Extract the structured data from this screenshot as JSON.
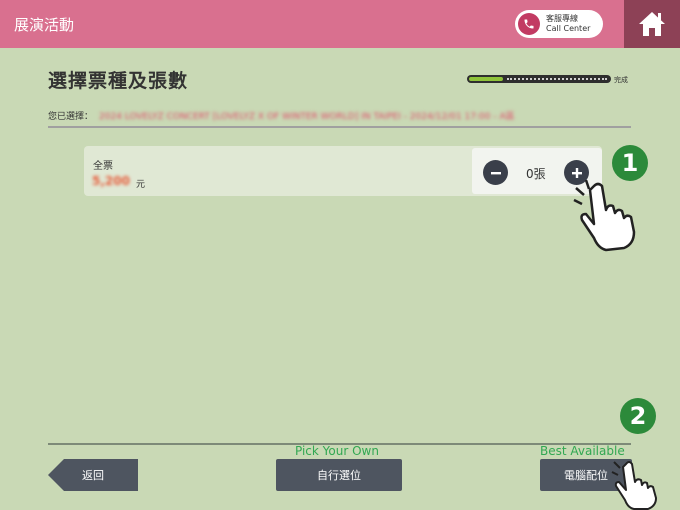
{
  "header": {
    "title": "展演活動",
    "call_center": {
      "line1": "客服專線",
      "line2": "Call Center"
    }
  },
  "page": {
    "title": "選擇票種及張數",
    "progress": {
      "label": "完成",
      "fraction": 0.25
    },
    "selected_label": "您已選擇：",
    "selected_value": "2024 LOVELYZ CONCERT [LOVELYZ X OF WINTER WORLD] IN TAIPEI - 2024/12/01 17:00 - A區"
  },
  "ticket": {
    "name": "全票",
    "price": "5,200",
    "unit": "元",
    "quantity": "0張"
  },
  "footer": {
    "back_label": "返回",
    "pick_own_caption": "Pick Your Own",
    "pick_own_label": "自行選位",
    "best_available_caption": "Best Available",
    "best_available_label": "電腦配位"
  },
  "badges": {
    "one": "1",
    "two": "2"
  },
  "colors": {
    "header": "#d9708f",
    "home": "#8d4156",
    "badge": "#2c8a3a",
    "background": "#c9d9b5"
  }
}
